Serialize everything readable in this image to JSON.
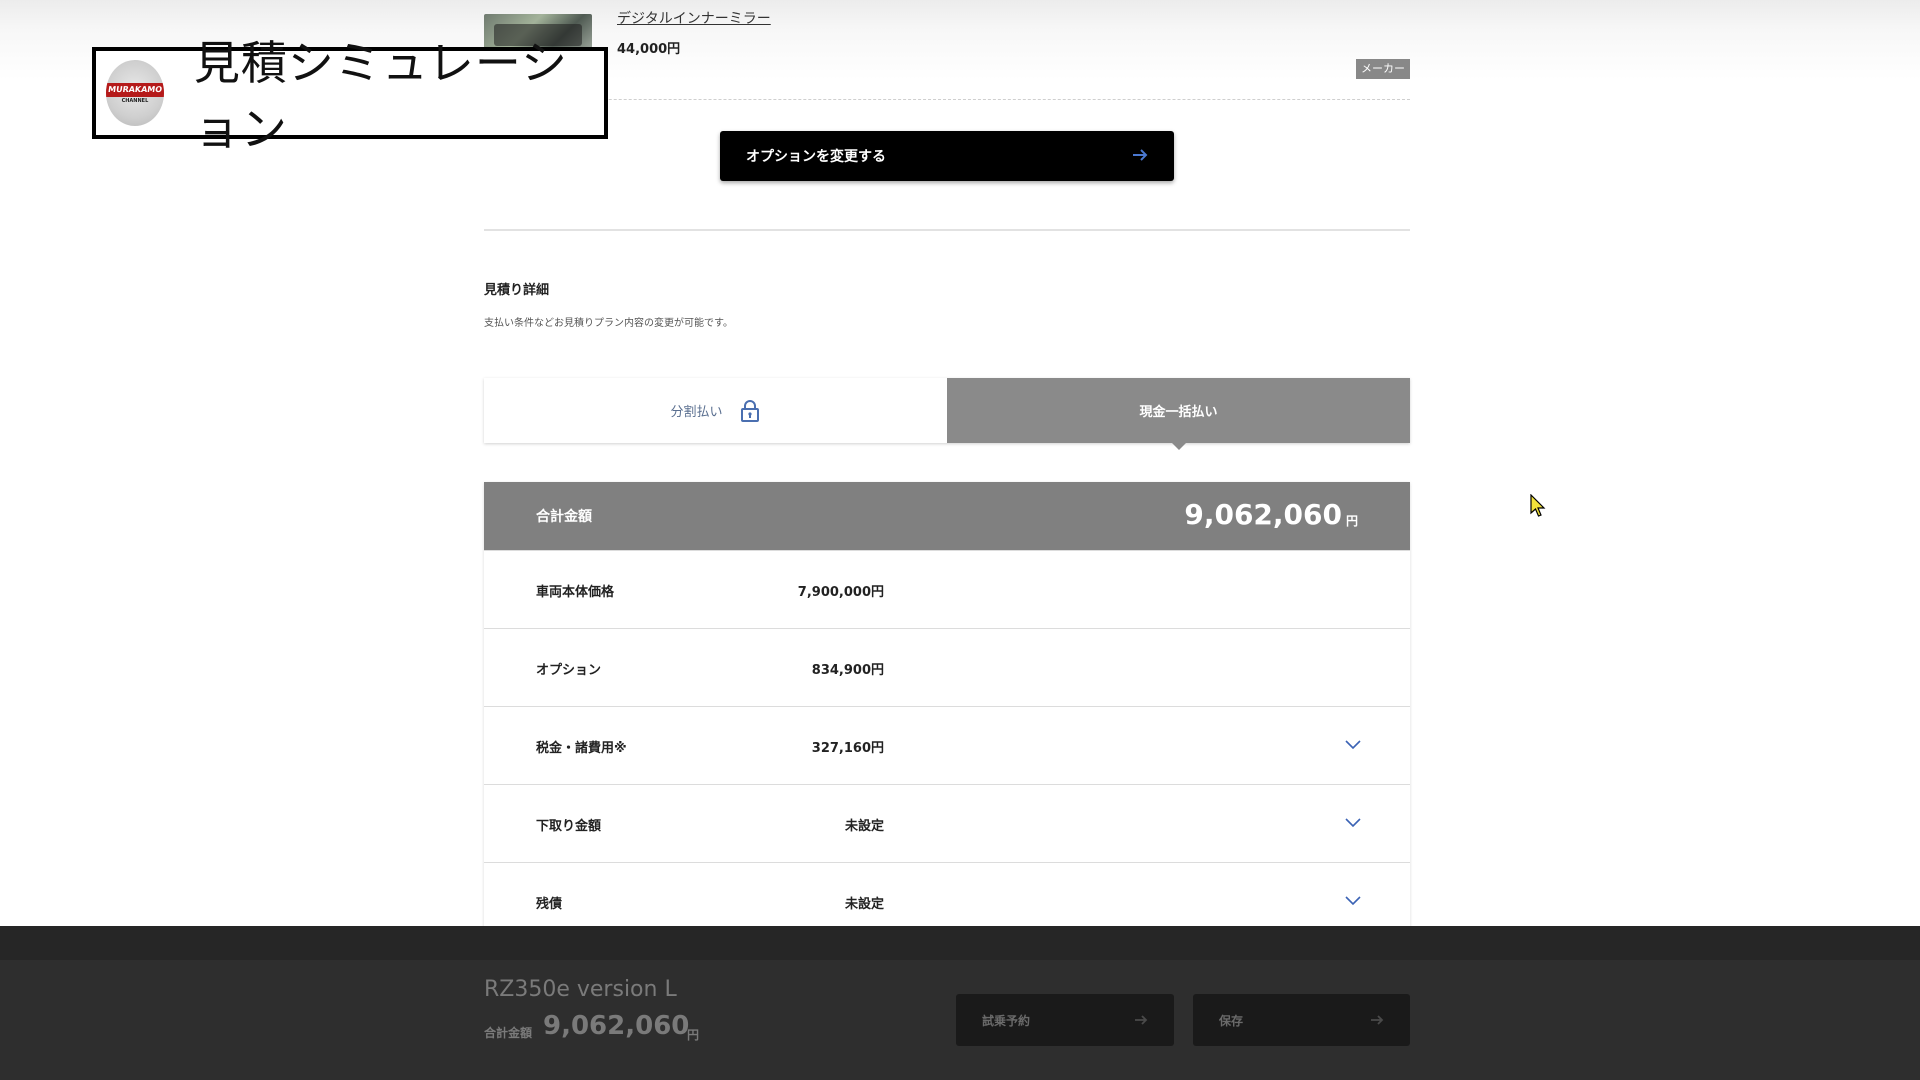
{
  "overlay": {
    "title": "見積シミュレーション",
    "channel_logo_text": "MURAKAMO",
    "channel_logo_sub": "CHANNEL"
  },
  "option_item": {
    "name": "デジタルインナーミラー",
    "price": "44,000円",
    "badge": "メーカー"
  },
  "change_option_button": {
    "label": "オプションを変更する"
  },
  "estimate_details": {
    "title": "見積り詳細",
    "description": "支払い条件などお見積りプラン内容の変更が可能です。"
  },
  "tabs": [
    {
      "label": "分割払い",
      "active": false,
      "locked": true
    },
    {
      "label": "現金一括払い",
      "active": true,
      "locked": false
    }
  ],
  "breakdown": {
    "total_label": "合計金額",
    "total_amount": "9,062,060",
    "total_unit": "円",
    "rows": [
      {
        "label": "車両本体価格",
        "value": "7,900,000円",
        "expandable": false
      },
      {
        "label": "オプション",
        "value": "834,900円",
        "expandable": false
      },
      {
        "label": "税金・諸費用※",
        "value": "327,160円",
        "expandable": true
      },
      {
        "label": "下取り金額",
        "value": "未設定",
        "expandable": true
      },
      {
        "label": "残債",
        "value": "未設定",
        "expandable": true
      }
    ]
  },
  "bottom_bar": {
    "model_name": "RZ350e version L",
    "total_label": "合計金額",
    "total_amount": "9,062,060",
    "total_unit": "円",
    "test_drive_label": "試乗予約",
    "save_label": "保存"
  },
  "colors": {
    "accent_blue": "#3b63b5",
    "total_bar": "#808080",
    "active_tab": "#8a8a8a",
    "bottom_bar": "#2e2e2e"
  }
}
